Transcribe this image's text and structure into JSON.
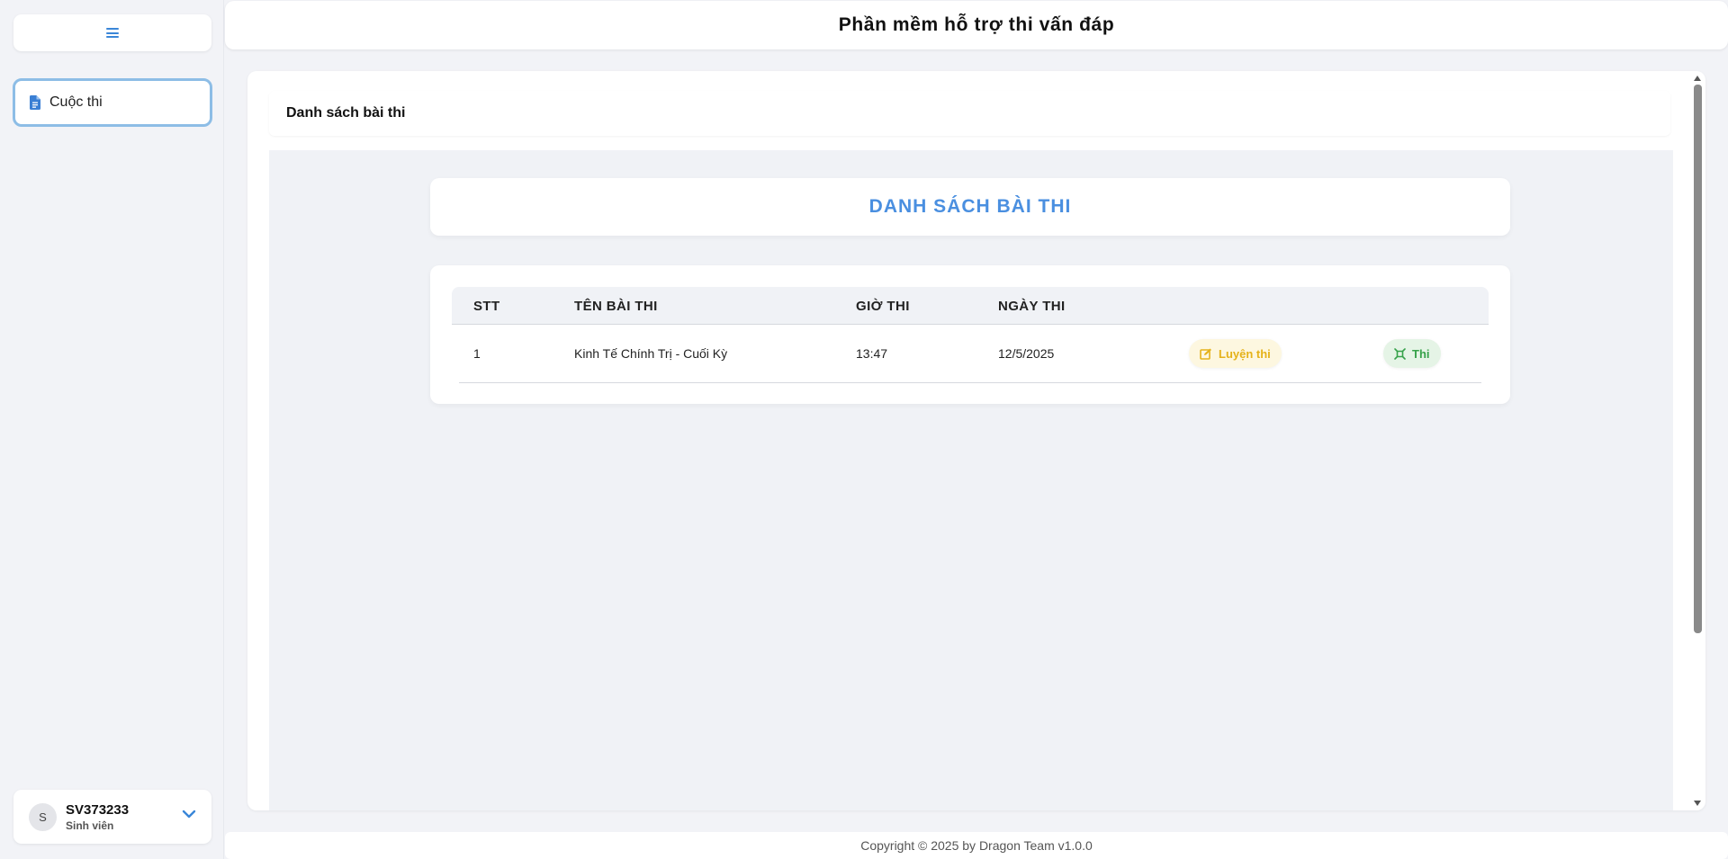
{
  "header": {
    "title": "Phần mềm hỗ trợ thi vấn đáp"
  },
  "sidebar": {
    "menu_icon": "hamburger-icon",
    "items": [
      {
        "label": "Cuộc thi",
        "icon": "document-icon",
        "active": true
      }
    ],
    "user": {
      "avatar_letter": "S",
      "id": "SV373233",
      "role": "Sinh viên"
    }
  },
  "main": {
    "breadcrumb_title": "Danh sách bài thi",
    "page_heading": "DANH SÁCH BÀI THI",
    "table": {
      "columns": [
        "STT",
        "TÊN BÀI THI",
        "GIỜ THI",
        "NGÀY THI"
      ],
      "rows": [
        {
          "stt": "1",
          "name": "Kinh Tế Chính Trị - Cuối Kỳ",
          "time": "13:47",
          "date": "12/5/2025",
          "practice_label": "Luyện thi",
          "exam_label": "Thi"
        }
      ]
    }
  },
  "footer": {
    "text": "Copyright © 2025 by Dragon Team v1.0.0"
  },
  "colors": {
    "accent": "#4a8fe0",
    "practice": "#e5b21a",
    "exam": "#36a24a"
  }
}
